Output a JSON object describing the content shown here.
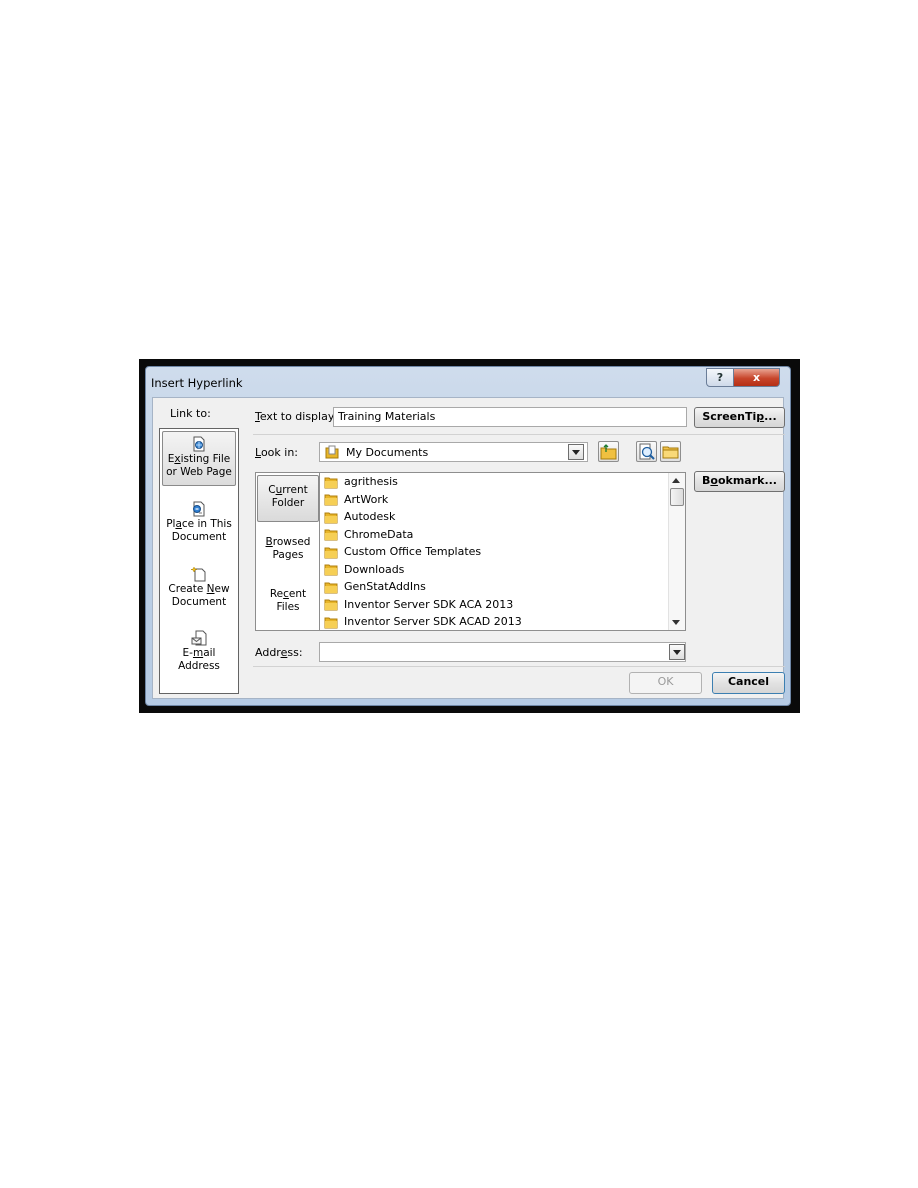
{
  "dialog": {
    "title": "Insert Hyperlink",
    "help_glyph": "?",
    "close_glyph": "x"
  },
  "link_to": {
    "label": "Link to:",
    "items": [
      {
        "line1_pre": "E",
        "line1_u": "x",
        "line1_post": "isting File",
        "line2": "or Web Page",
        "icon": "web-page-icon"
      },
      {
        "line1_pre": "Pl",
        "line1_u": "a",
        "line1_post": "ce in This",
        "line2": "Document",
        "icon": "place-in-document-icon"
      },
      {
        "line1_pre": "Create ",
        "line1_u": "N",
        "line1_post": "ew",
        "line2": "Document",
        "icon": "new-document-icon"
      },
      {
        "line1_pre": "E-",
        "line1_u": "m",
        "line1_post": "ail",
        "line2": "Address",
        "icon": "email-icon"
      }
    ]
  },
  "text_to_display": {
    "label_u": "T",
    "label_rest": "ext to display:",
    "value": "Training Materials"
  },
  "buttons": {
    "screentip_pre": "ScreenTi",
    "screentip_u": "p",
    "screentip_post": "...",
    "bookmark_pre": "B",
    "bookmark_u": "o",
    "bookmark_post": "okmark...",
    "ok": "OK",
    "cancel": "Cancel"
  },
  "look_in": {
    "label_u": "L",
    "label_rest": "ook in:",
    "value": "My Documents"
  },
  "browse_tabs": [
    {
      "line1_pre": "C",
      "line1_u": "u",
      "line1_post": "rrent",
      "line2": "Folder"
    },
    {
      "line1_pre": "",
      "line1_u": "B",
      "line1_post": "rowsed",
      "line2": "Pages"
    },
    {
      "line1_pre": "Re",
      "line1_u": "c",
      "line1_post": "ent",
      "line2": "Files"
    }
  ],
  "files": [
    "agrithesis",
    "ArtWork",
    "Autodesk",
    "ChromeData",
    "Custom Office Templates",
    "Downloads",
    "GenStatAddIns",
    "Inventor Server SDK ACA 2013",
    "Inventor Server SDK ACAD 2013"
  ],
  "address": {
    "label_pre": "Addr",
    "label_u": "e",
    "label_post": "ss:",
    "value": ""
  },
  "colors": {
    "frame": "#bdd0e6",
    "close_red": "#c7452b",
    "folder_yellow": "#e8b528"
  }
}
